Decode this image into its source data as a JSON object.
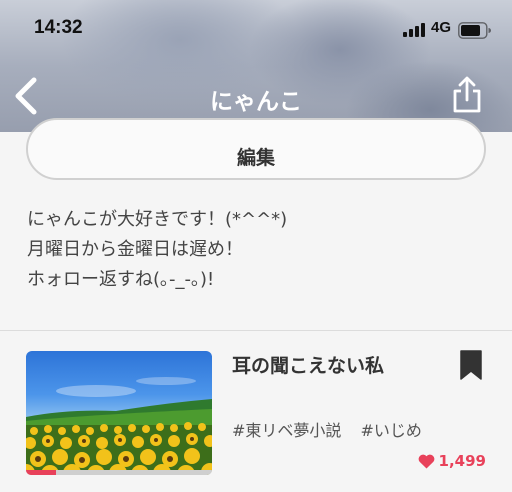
{
  "status_bar": {
    "time": "14:32",
    "network": "4G"
  },
  "nav": {
    "title": "にゃんこ",
    "back_icon": "chevron-left-icon",
    "share_icon": "share-icon"
  },
  "profile": {
    "edit_label": "編集",
    "bio": [
      "にゃんこが大好きです！(*^^*)",
      "月曜日から金曜日は遅め！",
      "ホォロー返すね(｡-_-｡)!"
    ]
  },
  "story": {
    "title": "耳の聞こえない私",
    "tags": [
      "#東リベ夢小説",
      "#いじめ"
    ],
    "likes": "1,499",
    "read_progress": 0.16,
    "bookmark_icon": "bookmark-icon",
    "heart_icon": "heart-icon"
  },
  "colors": {
    "accent": "#e8415a",
    "text": "#333333",
    "background": "#f5f5f5"
  }
}
